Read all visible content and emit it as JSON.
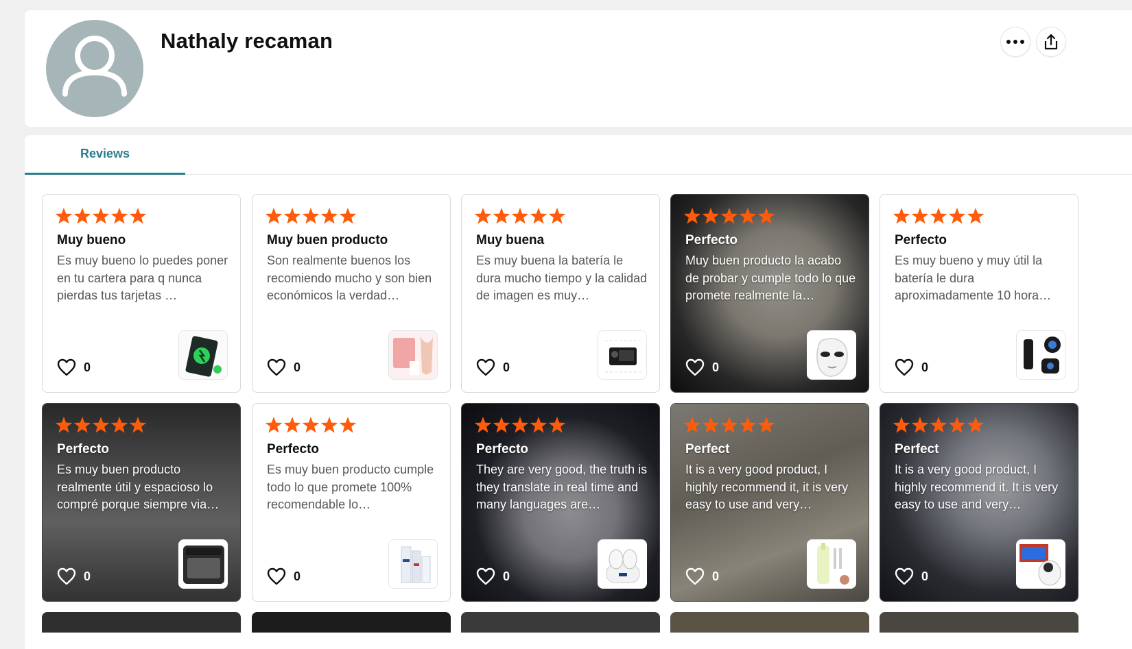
{
  "profile": {
    "name": "Nathaly recaman",
    "more_icon": "more-horizontal-icon",
    "share_icon": "share-icon"
  },
  "tabs": [
    {
      "label": "Reviews",
      "active": true
    }
  ],
  "colors": {
    "star": "#ff5b0a",
    "tab_accent": "#2a7c8c",
    "avatar_bg": "#a5b5b8"
  },
  "reviews": [
    {
      "rating": 5,
      "title": "Muy bueno",
      "text": "Es muy bueno lo puedes poner en tu cartera para q nunca pierdas tus tarjetas …",
      "likes": "0",
      "photo": false,
      "thumb": "wallet-tracker-card"
    },
    {
      "rating": 5,
      "title": "Muy buen producto",
      "text": "Son realmente buenos los recomiendo mucho y son bien económicos la verdad…",
      "likes": "0",
      "photo": false,
      "thumb": "pink-shapewear"
    },
    {
      "rating": 5,
      "title": "Muy buena",
      "text": "Es muy buena la batería le dura mucho tiempo y la calidad de imagen es muy…",
      "likes": "0",
      "photo": false,
      "thumb": "digital-camera"
    },
    {
      "rating": 5,
      "title": "Perfecto",
      "text": "Muy buen producto la acabo de probar y cumple todo lo que promete realmente la…",
      "likes": "0",
      "photo": true,
      "thumb": "led-face-mask"
    },
    {
      "rating": 5,
      "title": "Perfecto",
      "text": "Es muy bueno y muy útil la batería le dura aproximadamente 10 hora…",
      "likes": "0",
      "photo": false,
      "thumb": "clip-fan"
    },
    {
      "rating": 5,
      "title": "Perfecto",
      "text": "Es muy buen producto realmente útil y espacioso lo compré porque siempre via…",
      "likes": "0",
      "photo": true,
      "thumb": "car-trunk-mattress"
    },
    {
      "rating": 5,
      "title": "Perfecto",
      "text": "Es muy buen producto cumple todo lo que promete 100% recomendable lo…",
      "likes": "0",
      "photo": false,
      "thumb": "skincare-set"
    },
    {
      "rating": 5,
      "title": "Perfecto",
      "text": "They are very good, the truth is they translate in real time and many languages are…",
      "likes": "0",
      "photo": true,
      "thumb": "translator-earbuds"
    },
    {
      "rating": 5,
      "title": "Perfect",
      "text": "It is a very good product, I highly recommend it, it is very easy to use and very…",
      "likes": "0",
      "photo": true,
      "thumb": "facial-brush-kit"
    },
    {
      "rating": 5,
      "title": "Perfect",
      "text": "It is a very good product, I highly recommend it. It is very easy to use and very…",
      "likes": "0",
      "photo": true,
      "thumb": "mini-projector"
    }
  ]
}
